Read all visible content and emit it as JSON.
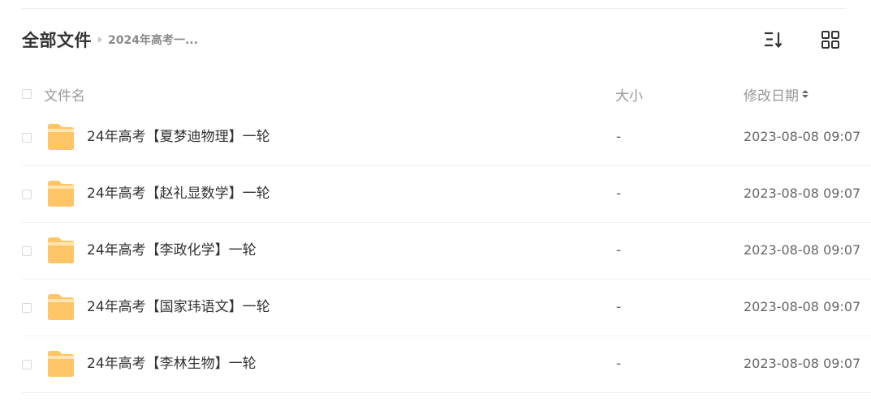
{
  "breadcrumb": {
    "root": "全部文件",
    "current": "2024年高考一..."
  },
  "toolbar": {
    "sort_icon": "sort-list-icon",
    "view_icon": "grid-view-icon"
  },
  "columns": {
    "name": "文件名",
    "size": "大小",
    "modified": "修改日期"
  },
  "colors": {
    "folder": "#ffc567",
    "folder_tab": "#ffd98c",
    "text": "#333333",
    "muted": "#999999"
  },
  "files": [
    {
      "name": "24年高考【夏梦迪物理】一轮",
      "size": "-",
      "modified": "2023-08-08 09:07",
      "icon": "folder-icon"
    },
    {
      "name": "24年高考【赵礼显数学】一轮",
      "size": "-",
      "modified": "2023-08-08 09:07",
      "icon": "folder-icon"
    },
    {
      "name": "24年高考【李政化学】一轮",
      "size": "-",
      "modified": "2023-08-08 09:07",
      "icon": "folder-icon"
    },
    {
      "name": "24年高考【国家玮语文】一轮",
      "size": "-",
      "modified": "2023-08-08 09:07",
      "icon": "folder-icon"
    },
    {
      "name": "24年高考【李林生物】一轮",
      "size": "-",
      "modified": "2023-08-08 09:07",
      "icon": "folder-icon"
    }
  ]
}
